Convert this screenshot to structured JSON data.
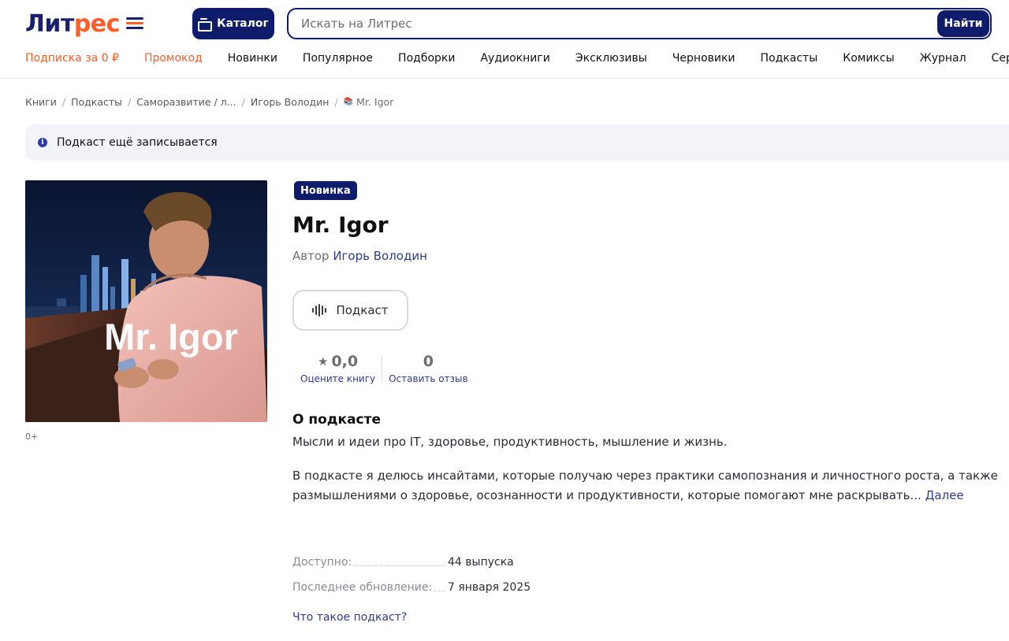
{
  "header": {
    "logo_part1": "Лит",
    "logo_part2": "рес",
    "catalog_label": "Каталог",
    "search_placeholder": "Искать на Литрес",
    "search_button": "Найти"
  },
  "nav": [
    {
      "label": "Подписка за 0 ₽",
      "accent": true
    },
    {
      "label": "Промокод",
      "accent": true
    },
    {
      "label": "Новинки"
    },
    {
      "label": "Популярное"
    },
    {
      "label": "Подборки"
    },
    {
      "label": "Аудиокниги"
    },
    {
      "label": "Эксклюзивы"
    },
    {
      "label": "Черновики"
    },
    {
      "label": "Подкасты"
    },
    {
      "label": "Комиксы"
    },
    {
      "label": "Журнал"
    },
    {
      "label": "Сертификаты"
    }
  ],
  "breadcrumbs": [
    "Книги",
    "Подкасты",
    "Саморазвитие / л...",
    "Игорь Володин",
    "Mr. Igor"
  ],
  "banner": {
    "text": "Подкаст ещё записывается"
  },
  "cover": {
    "title": "Mr. Igor",
    "age_rating": "0+"
  },
  "book": {
    "badge": "Новинка",
    "title": "Mr. Igor",
    "author_prefix": "Автор",
    "author": "Игорь Володин",
    "type_label": "Подкаст"
  },
  "rating": {
    "value": "0,0",
    "rate_link": "Оцените книгу",
    "reviews_count": "0",
    "review_link": "Оставить отзыв"
  },
  "about": {
    "title": "О подкасте",
    "summary": "Мысли и идеи про IT, здоровье, продуктивность, мышление и жизнь.",
    "description": "В подкасте я делюсь инсайтами, которые получаю через практики самопознания и личностного роста, а также размышлениями о здоровье, осознанности и продуктивности, которые помогают мне раскрывать...",
    "more_link": "Далее"
  },
  "meta": [
    {
      "label": "Доступно:",
      "value": "44 выпуска"
    },
    {
      "label": "Последнее обновление:",
      "value": "7 января 2025"
    }
  ],
  "what_is_podcast": "Что такое подкаст?",
  "colors": {
    "brand_navy": "#0e1c6b",
    "brand_orange": "#ff5c28",
    "link": "#2f3a8f"
  }
}
